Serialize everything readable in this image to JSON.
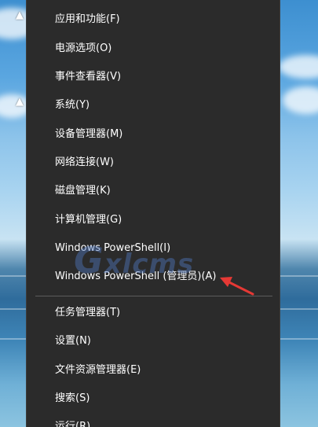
{
  "menu": {
    "items": [
      {
        "label": "应用和功能(F)"
      },
      {
        "label": "电源选项(O)"
      },
      {
        "label": "事件查看器(V)"
      },
      {
        "label": "系统(Y)"
      },
      {
        "label": "设备管理器(M)"
      },
      {
        "label": "网络连接(W)"
      },
      {
        "label": "磁盘管理(K)"
      },
      {
        "label": "计算机管理(G)"
      },
      {
        "label": "Windows PowerShell(I)"
      },
      {
        "label": "Windows PowerShell (管理员)(A)"
      },
      {
        "label": "任务管理器(T)"
      },
      {
        "label": "设置(N)"
      },
      {
        "label": "文件资源管理器(E)"
      },
      {
        "label": "搜索(S)"
      },
      {
        "label": "运行(R)"
      }
    ]
  },
  "watermark": {
    "text": "Gxlcms"
  },
  "highlight": {
    "arrow_color": "#e53935"
  }
}
